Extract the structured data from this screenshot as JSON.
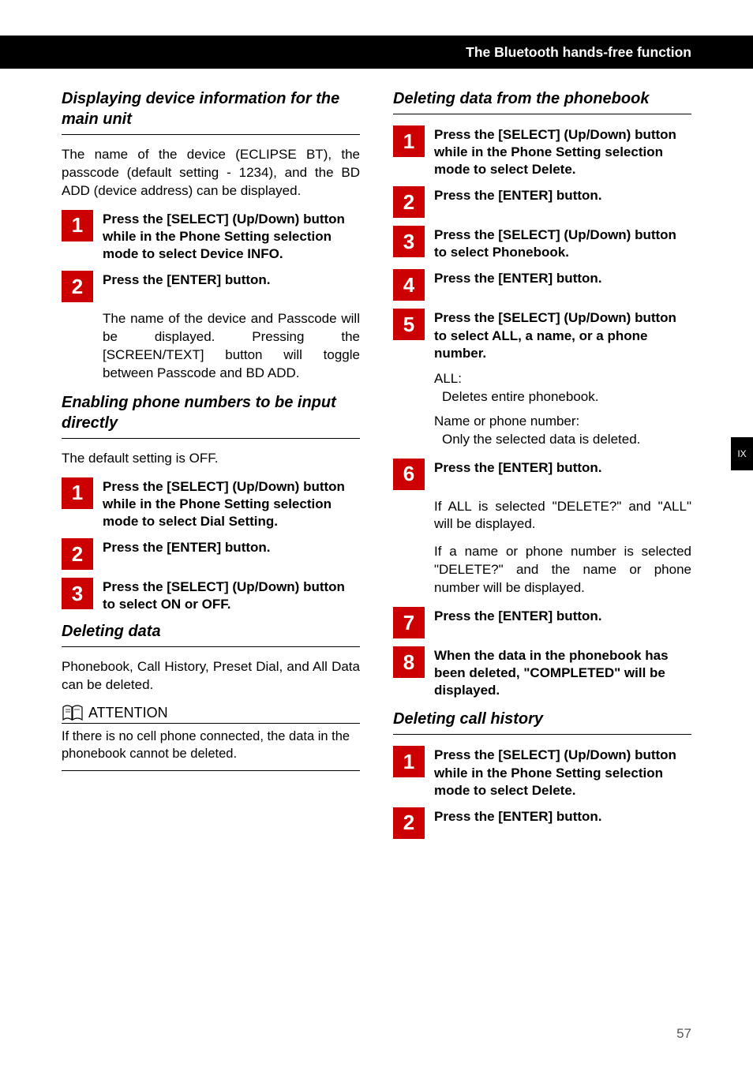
{
  "header": {
    "title": "The Bluetooth hands-free function"
  },
  "side_tab": "IX",
  "page_number": "57",
  "left": {
    "s1": {
      "title": "Displaying device information for the main unit",
      "intro": "The name of the device (ECLIPSE BT), the passcode (default setting - 1234), and the BD ADD (device address) can be displayed.",
      "st1": "Press the [SELECT] (Up/Down) button while in the Phone Setting selection mode to select Device INFO.",
      "st2": "Press the [ENTER] button.",
      "sub2": "The name of the device and Passcode will be displayed. Pressing the [SCREEN/TEXT] button will toggle between Passcode and BD ADD."
    },
    "s2": {
      "title": "Enabling phone numbers to be input directly",
      "intro": "The default setting is OFF.",
      "st1": "Press the [SELECT] (Up/Down) button while in the Phone Setting selection mode to select Dial Setting.",
      "st2": "Press the [ENTER] button.",
      "st3": "Press the [SELECT] (Up/Down) button to select ON or OFF."
    },
    "s3": {
      "title": "Deleting data",
      "intro": "Phonebook, Call History, Preset Dial, and All Data can be deleted.",
      "att_label": "ATTENTION",
      "att_text": "If there is no cell phone connected, the data in the phonebook cannot be deleted."
    }
  },
  "right": {
    "s1": {
      "title": "Deleting data from the phonebook",
      "st1": "Press the [SELECT] (Up/Down) button while in the Phone Setting selection mode to select Delete.",
      "st2": "Press the [ENTER] button.",
      "st3": "Press the [SELECT] (Up/Down) button to select Phonebook.",
      "st4": "Press the [ENTER] button.",
      "st5": "Press the [SELECT] (Up/Down) button to select ALL, a name, or a phone number.",
      "sub5a": "ALL:",
      "sub5a2": "Deletes entire phonebook.",
      "sub5b": "Name or phone number:",
      "sub5b2": "Only the selected data is deleted.",
      "st6": "Press the [ENTER] button.",
      "sub6a": "If ALL is selected \"DELETE?\" and \"ALL\" will be displayed.",
      "sub6b": "If a name or phone number is selected \"DELETE?\" and the name or phone number will be displayed.",
      "st7": "Press the [ENTER] button.",
      "st8": "When the data in the phonebook has been deleted, \"COMPLETED\" will be displayed."
    },
    "s2": {
      "title": "Deleting call history",
      "st1": "Press the [SELECT] (Up/Down) button while in the Phone Setting selection mode to select Delete.",
      "st2": "Press the [ENTER] button."
    }
  }
}
